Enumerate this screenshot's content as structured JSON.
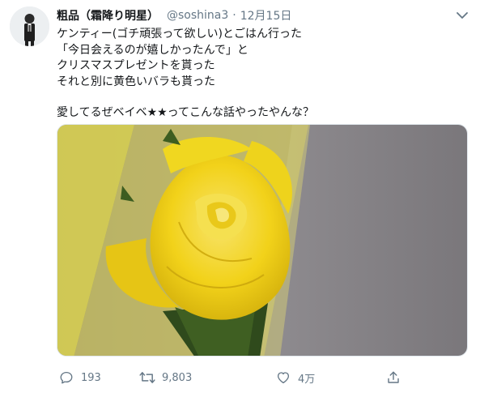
{
  "tweet": {
    "display_name": "粗品（霜降り明星）",
    "handle": "@soshina3",
    "separator": "·",
    "date": "12月15日",
    "lines": [
      "ケンティー(ゴチ頑張って欲しい)とごはん行った",
      "「今日会えるのが嬉しかったんで」と",
      "クリスマスプレゼントを貰った",
      "それと別に黄色いバラも貰った"
    ],
    "closing_line": "愛してるぜベイベ★★ってこんな話やったやんな？",
    "media_subject": "yellow-rose"
  },
  "actions": {
    "replies": "193",
    "retweets": "9,803",
    "likes": "4万"
  },
  "colors": {
    "text": "#14171a",
    "secondary": "#657786",
    "rose": "#f2d21a"
  }
}
